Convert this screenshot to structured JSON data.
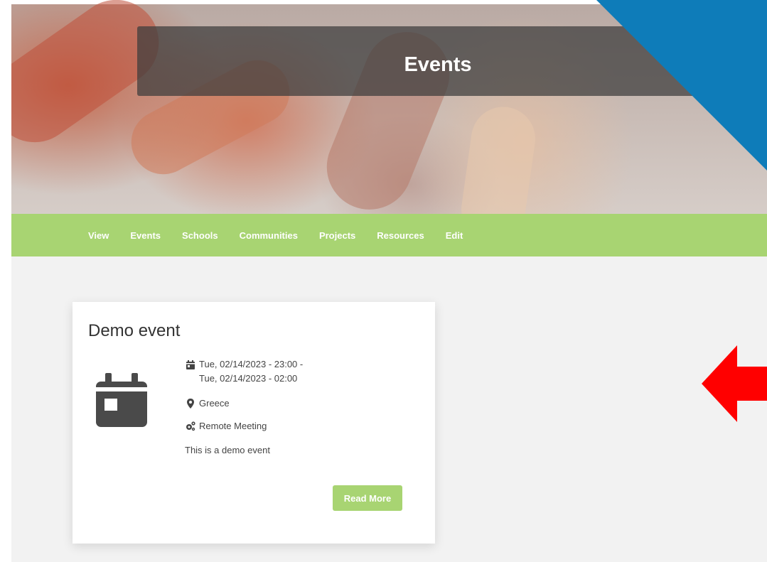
{
  "hero": {
    "title": "Events"
  },
  "nav": {
    "items": [
      {
        "label": "View"
      },
      {
        "label": "Events"
      },
      {
        "label": "Schools"
      },
      {
        "label": "Communities"
      },
      {
        "label": "Projects"
      },
      {
        "label": "Resources"
      },
      {
        "label": "Edit"
      }
    ]
  },
  "event_card": {
    "title": "Demo event",
    "date_line_1": "Tue, 02/14/2023 - 23:00 -",
    "date_line_2": "Tue, 02/14/2023 - 02:00",
    "location": "Greece",
    "type": "Remote Meeting",
    "description": "This is a demo event",
    "read_more_label": "Read More",
    "icon": "calendar-icon"
  },
  "colors": {
    "nav_green": "#a8d472",
    "button_green": "#a8d472",
    "corner_blue": "#0e7cb9",
    "arrow_red": "#ff0000",
    "icon_dark": "#4a4a4a"
  }
}
